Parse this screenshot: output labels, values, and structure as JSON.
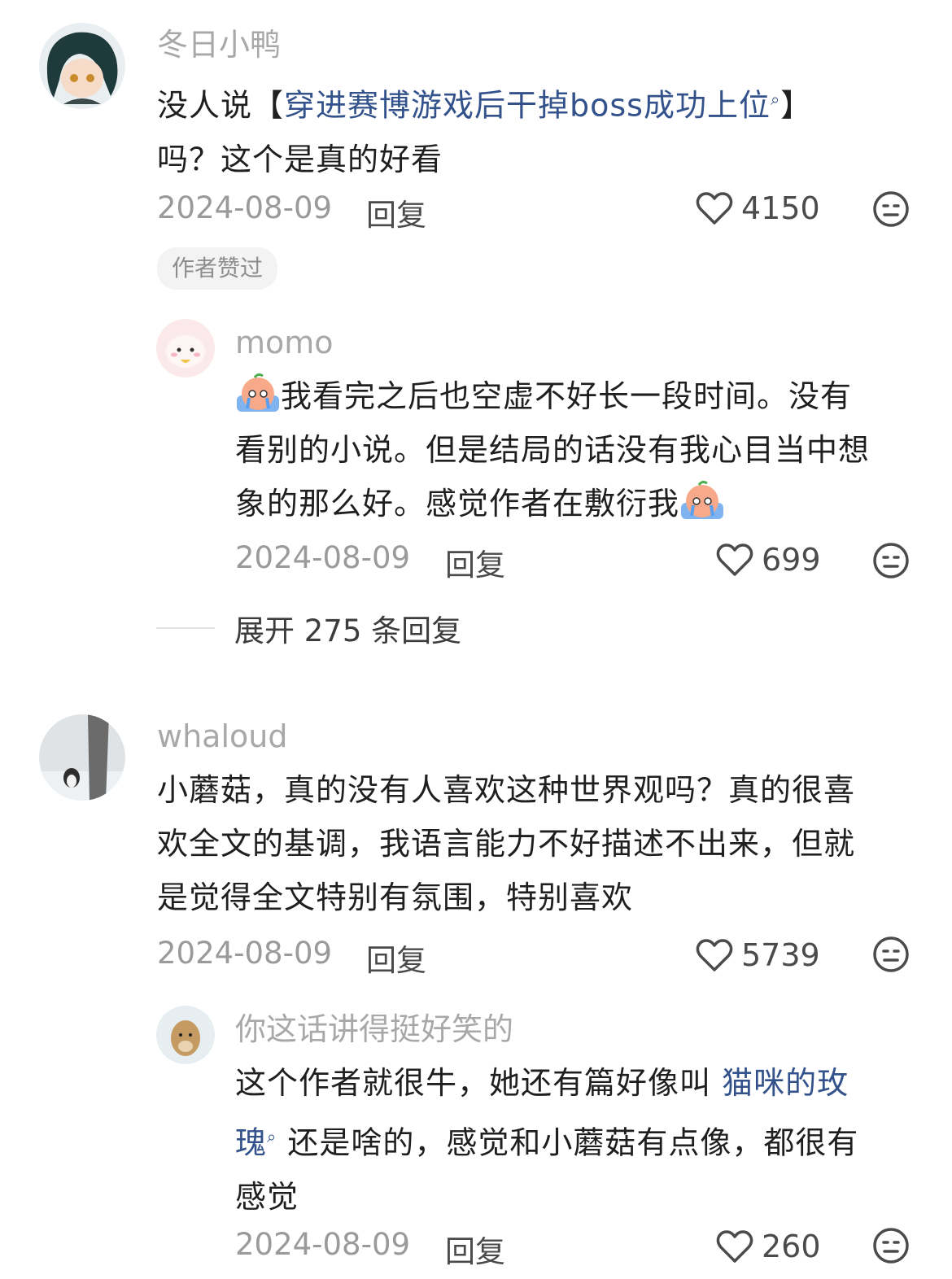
{
  "comments": [
    {
      "username": "冬日小鸭",
      "text_before": "没人说【",
      "link": "穿进赛博游戏后干掉boss成功上位",
      "search_icon": "search-icon",
      "text_after": "】",
      "line2": "吗？这个是真的好看",
      "date": "2024-08-09",
      "reply_label": "回复",
      "likes": "4150",
      "badge": "作者赞过",
      "reply": {
        "username": "momo",
        "line1": "我看完之后也空虚不好长一段时间。没有",
        "line2": "看别的小说。但是结局的话没有我心目当中想",
        "line3": "象的那么好。感觉作者在敷衍我",
        "emoji": "crying-peach-emoji",
        "date": "2024-08-09",
        "reply_label": "回复",
        "likes": "699"
      },
      "expand_label": "展开 275 条回复"
    },
    {
      "username": "whaloud",
      "line1": "小蘑菇，真的没有人喜欢这种世界观吗？真的很喜",
      "line2": "欢全文的基调，我语言能力不好描述不出来，但就",
      "line3": "是觉得全文特别有氛围，特别喜欢",
      "date": "2024-08-09",
      "reply_label": "回复",
      "likes": "5739",
      "reply": {
        "username": "你这话讲得挺好笑的",
        "line1_before": "这个作者就很牛，她还有篇好像叫",
        "line1_link": "猫咪的玫",
        "line2_link": "瑰",
        "line2_after": "还是啥的，感觉和小蘑菇有点像，都很有",
        "line3": "感觉",
        "date": "2024-08-09",
        "reply_label": "回复",
        "likes": "260"
      }
    }
  ],
  "icons": {
    "like": "heart-outline-icon",
    "dislike": "meh-face-icon"
  },
  "colors": {
    "link": "#33528c",
    "username": "#a8a8a8",
    "text": "#1f1f1f"
  }
}
